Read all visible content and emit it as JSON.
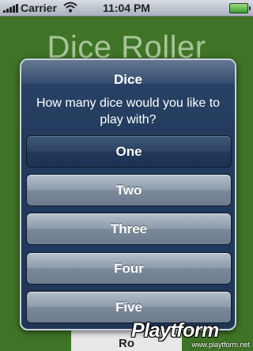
{
  "status_bar": {
    "carrier": "Carrier",
    "time": "11:04 PM",
    "icons": [
      "signal-bars-icon",
      "wifi-icon",
      "battery-icon"
    ]
  },
  "app": {
    "title": "Dice Roller",
    "bottom_button_label": "Ro"
  },
  "alert": {
    "title": "Dice",
    "message": "How many dice would you like to play with?",
    "buttons": [
      "One",
      "Two",
      "Three",
      "Four",
      "Five"
    ]
  },
  "watermark": {
    "logo": "Playtform",
    "url": "www.playtform.net"
  }
}
